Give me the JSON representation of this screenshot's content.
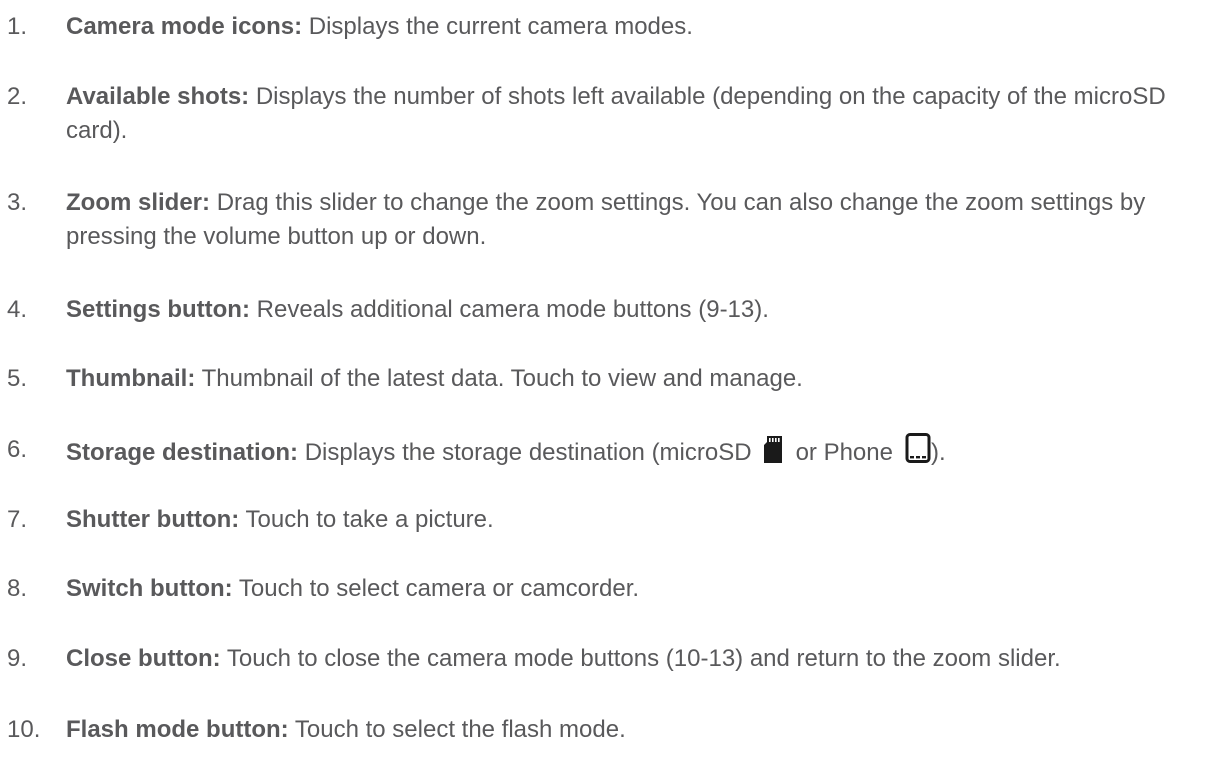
{
  "items": [
    {
      "num": "1.",
      "term": "Camera mode icons:",
      "desc": "Displays the current camera modes."
    },
    {
      "num": "2.",
      "term": "Available shots:",
      "desc": "Displays the number of shots left available (depending on the capacity of the microSD card)."
    },
    {
      "num": "3.",
      "term": "Zoom slider:",
      "desc": "Drag this slider to change the zoom settings. You can also change the zoom settings by pressing the volume button up or down."
    },
    {
      "num": "4.",
      "term": "Settings button:",
      "desc": "Reveals additional camera mode buttons (9-13)."
    },
    {
      "num": "5.",
      "term": "Thumbnail:",
      "desc": "Thumbnail of the latest data. Touch to view and manage."
    },
    {
      "num": "6.",
      "term": "Storage destination:",
      "desc_a": "Displays the storage destination (microSD",
      "desc_b": "or Phone",
      "desc_c": ")."
    },
    {
      "num": "7.",
      "term": "Shutter button:",
      "desc": "Touch to take a picture."
    },
    {
      "num": "8.",
      "term": "Switch button:",
      "desc": "Touch to select camera or camcorder."
    },
    {
      "num": "9.",
      "term": "Close button:",
      "desc": "Touch to close the camera mode buttons (10-13) and return to the zoom slider."
    },
    {
      "num": "10.",
      "term": "Flash mode button:",
      "desc": "Touch to select the flash mode."
    }
  ],
  "icons": {
    "microsd": "microsd-card-icon",
    "phone": "phone-icon"
  },
  "colors": {
    "text": "#59595b",
    "icon": "#1a1a1a"
  }
}
